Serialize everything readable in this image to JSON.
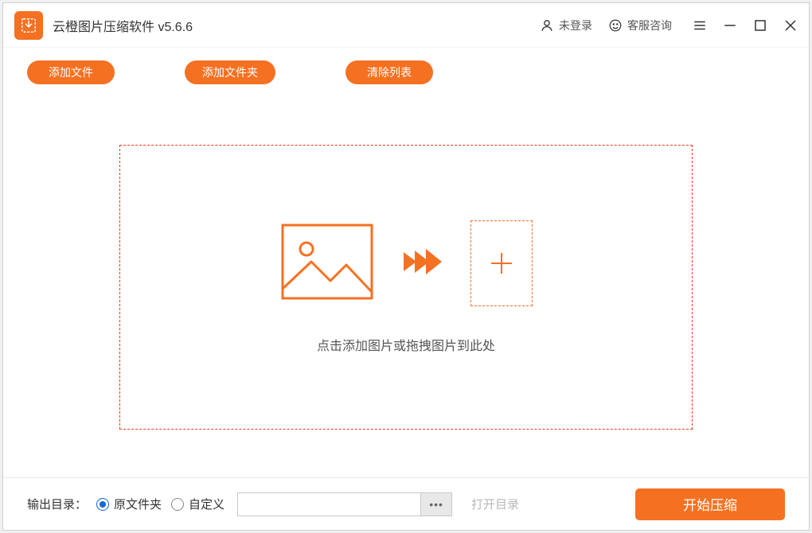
{
  "titlebar": {
    "app_title": "云橙图片压缩软件 v5.6.6",
    "login_label": "未登录",
    "support_label": "客服咨询"
  },
  "toolbar": {
    "add_file_label": "添加文件",
    "add_folder_label": "添加文件夹",
    "clear_list_label": "清除列表"
  },
  "dropzone": {
    "hint": "点击添加图片或拖拽图片到此处"
  },
  "footer": {
    "output_label": "输出目录：",
    "radio_original_label": "原文件夹",
    "radio_custom_label": "自定义",
    "path_value": "",
    "browse_label": "•••",
    "open_dir_label": "打开目录",
    "start_label": "开始压缩",
    "selected_output": "original"
  },
  "colors": {
    "accent": "#f57122",
    "border_dashed": "#e73a18",
    "radio_active": "#1568d0"
  }
}
